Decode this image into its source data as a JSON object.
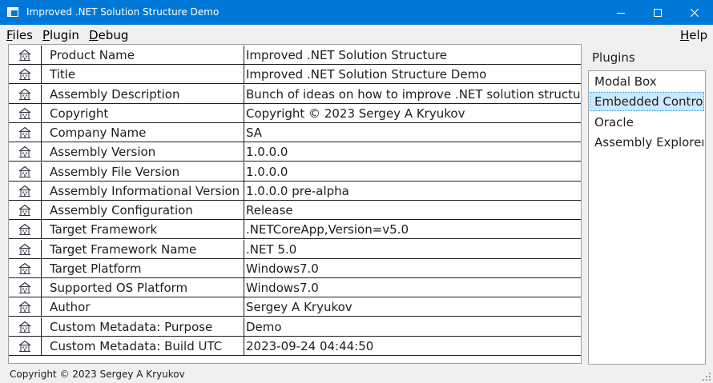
{
  "window": {
    "title": "Improved .NET Solution Structure Demo",
    "icon": "app-window-icon",
    "controls": [
      "minimize-icon",
      "maximize-icon",
      "close-icon"
    ]
  },
  "menu": {
    "files": "Files",
    "plugin": "Plugin",
    "debug": "Debug",
    "help": "Help"
  },
  "properties": [
    {
      "name": "Product Name",
      "value": "Improved .NET Solution Structure"
    },
    {
      "name": "Title",
      "value": "Improved .NET Solution Structure Demo"
    },
    {
      "name": "Assembly Description",
      "value": "Bunch of ideas on how to improve .NET solution structure"
    },
    {
      "name": "Copyright",
      "value": "Copyright © 2023 Sergey A Kryukov"
    },
    {
      "name": "Company Name",
      "value": "SA"
    },
    {
      "name": "Assembly Version",
      "value": "1.0.0.0"
    },
    {
      "name": "Assembly File Version",
      "value": "1.0.0.0"
    },
    {
      "name": "Assembly Informational Version",
      "value": "1.0.0.0 pre-alpha"
    },
    {
      "name": "Assembly Configuration",
      "value": "Release"
    },
    {
      "name": "Target Framework",
      "value": ".NETCoreApp,Version=v5.0"
    },
    {
      "name": "Target Framework Name",
      "value": ".NET 5.0"
    },
    {
      "name": "Target Platform",
      "value": "Windows7.0"
    },
    {
      "name": "Supported OS Platform",
      "value": "Windows7.0"
    },
    {
      "name": "Author",
      "value": "Sergey A Kryukov"
    },
    {
      "name": "Custom Metadata: Purpose",
      "value": "Demo"
    },
    {
      "name": "Custom Metadata: Build UTC",
      "value": "2023-09-24 04:44:50"
    }
  ],
  "row_icon": "building-icon",
  "plugins": {
    "label": "Plugins",
    "items": [
      "Modal Box",
      "Embedded Control",
      "Oracle",
      "Assembly Explorer"
    ],
    "selected": "Embedded Control"
  },
  "status": {
    "text": "Copyright © 2023 Sergey A Kryukov"
  },
  "colors": {
    "titlebar": "#0078d7",
    "selection": "#cce8ff",
    "selection_border": "#26a0da"
  }
}
